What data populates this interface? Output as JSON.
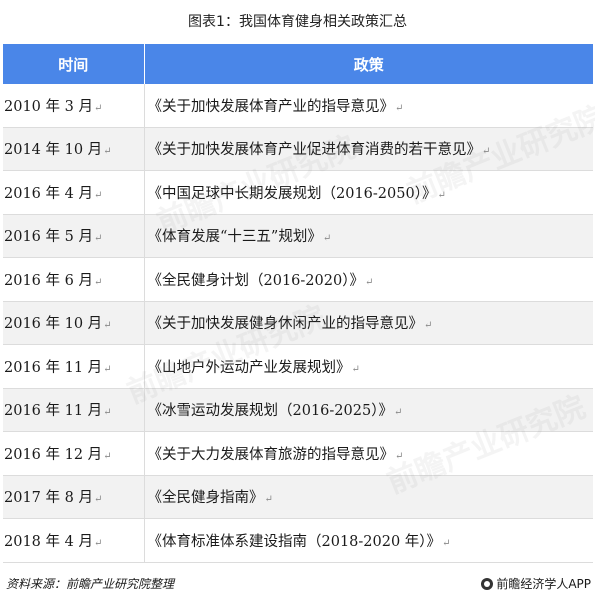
{
  "title": "图表1：我国体育健身相关政策汇总",
  "table": {
    "headers": [
      "时间",
      "政策"
    ],
    "rows": [
      {
        "time": "2010 年 3 月",
        "policy": "《关于加快发展体育产业的指导意见》"
      },
      {
        "time": "2014 年 10 月",
        "policy": "《关于加快发展体育产业促进体育消费的若干意见》"
      },
      {
        "time": "2016 年 4 月",
        "policy": "《中国足球中长期发展规划（2016-2050）》"
      },
      {
        "time": "2016 年 5 月",
        "policy": "《体育发展“十三五”规划》"
      },
      {
        "time": "2016 年 6 月",
        "policy": "《全民健身计划（2016-2020）》"
      },
      {
        "time": "2016 年 10 月",
        "policy": "《关于加快发展健身休闲产业的指导意见》"
      },
      {
        "time": "2016 年 11 月",
        "policy": "《山地户外运动产业发展规划》"
      },
      {
        "time": "2016 年 11 月",
        "policy": "《冰雪运动发展规划（2016-2025）》"
      },
      {
        "time": "2016 年 12 月",
        "policy": "《关于大力发展体育旅游的指导意见》"
      },
      {
        "time": "2017 年 8 月",
        "policy": "《全民健身指南》"
      },
      {
        "time": "2018 年 4 月",
        "policy": "《体育标准体系建设指南（2018-2020 年）》"
      }
    ]
  },
  "footer": {
    "source": "资料来源：前瞻产业研究院整理",
    "brand": "前瞻经济学人APP",
    "brand_icon": "qianzhan-logo-icon"
  },
  "watermark": {
    "text": "前瞻产业研究院"
  }
}
